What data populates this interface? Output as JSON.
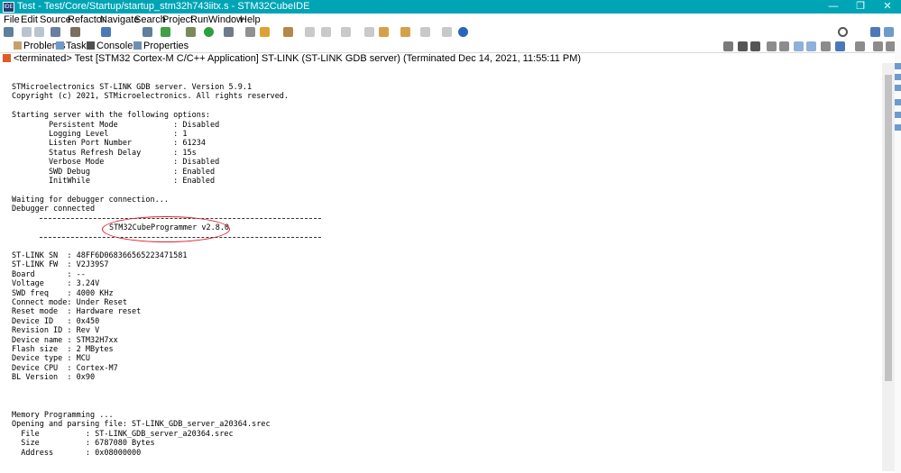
{
  "window": {
    "title": "Test - Test/Core/Startup/startup_stm32h743iitx.s - STM32CubeIDE",
    "app_icon_text": "IDE",
    "controls": [
      "—",
      "❐",
      "✕"
    ]
  },
  "menu": [
    "File",
    "Edit",
    "Source",
    "Refactor",
    "Navigate",
    "Search",
    "Project",
    "Run",
    "Window",
    "Help"
  ],
  "tabs": [
    "Problems",
    "Tasks",
    "Console",
    "Properties"
  ],
  "console_status": "<terminated> Test [STM32 Cortex-M C/C++ Application] ST-LINK (ST-LINK GDB server) (Terminated Dec 14, 2021, 11:55:11 PM)",
  "console": {
    "lines_top": "STMicroelectronics ST-LINK GDB server. Version 5.9.1\nCopyright (c) 2021, STMicroelectronics. All rights reserved.\n\nStarting server with the following options:\n        Persistent Mode            : Disabled\n        Logging Level              : 1\n        Listen Port Number         : 61234\n        Status Refresh Delay       : 15s\n        Verbose Mode               : Disabled\n        SWD Debug                  : Enabled\n        InitWhile                  : Enabled\n\nWaiting for debugger connection...\nDebugger connected",
    "programmer": "STM32CubeProgrammer v2.8.0",
    "lines_bottom": "ST-LINK SN  : 48FF6D068366565223471581\nST-LINK FW  : V2J39S7\nBoard       : --\nVoltage     : 3.24V\nSWD freq    : 4000 KHz\nConnect mode: Under Reset\nReset mode  : Hardware reset\nDevice ID   : 0x450\nRevision ID : Rev V\nDevice name : STM32H7xx\nFlash size  : 2 MBytes\nDevice type : MCU\nDevice CPU  : Cortex-M7\nBL Version  : 0x90\n\n\n\nMemory Programming ...\nOpening and parsing file: ST-LINK_GDB_server_a20364.srec\n  File          : ST-LINK_GDB_server_a20364.srec\n  Size          : 6787080 Bytes\n  Address       : 0x08000000"
  },
  "colors": {
    "titlebar": "#00a5b5",
    "annotation": "#e01e2d"
  }
}
